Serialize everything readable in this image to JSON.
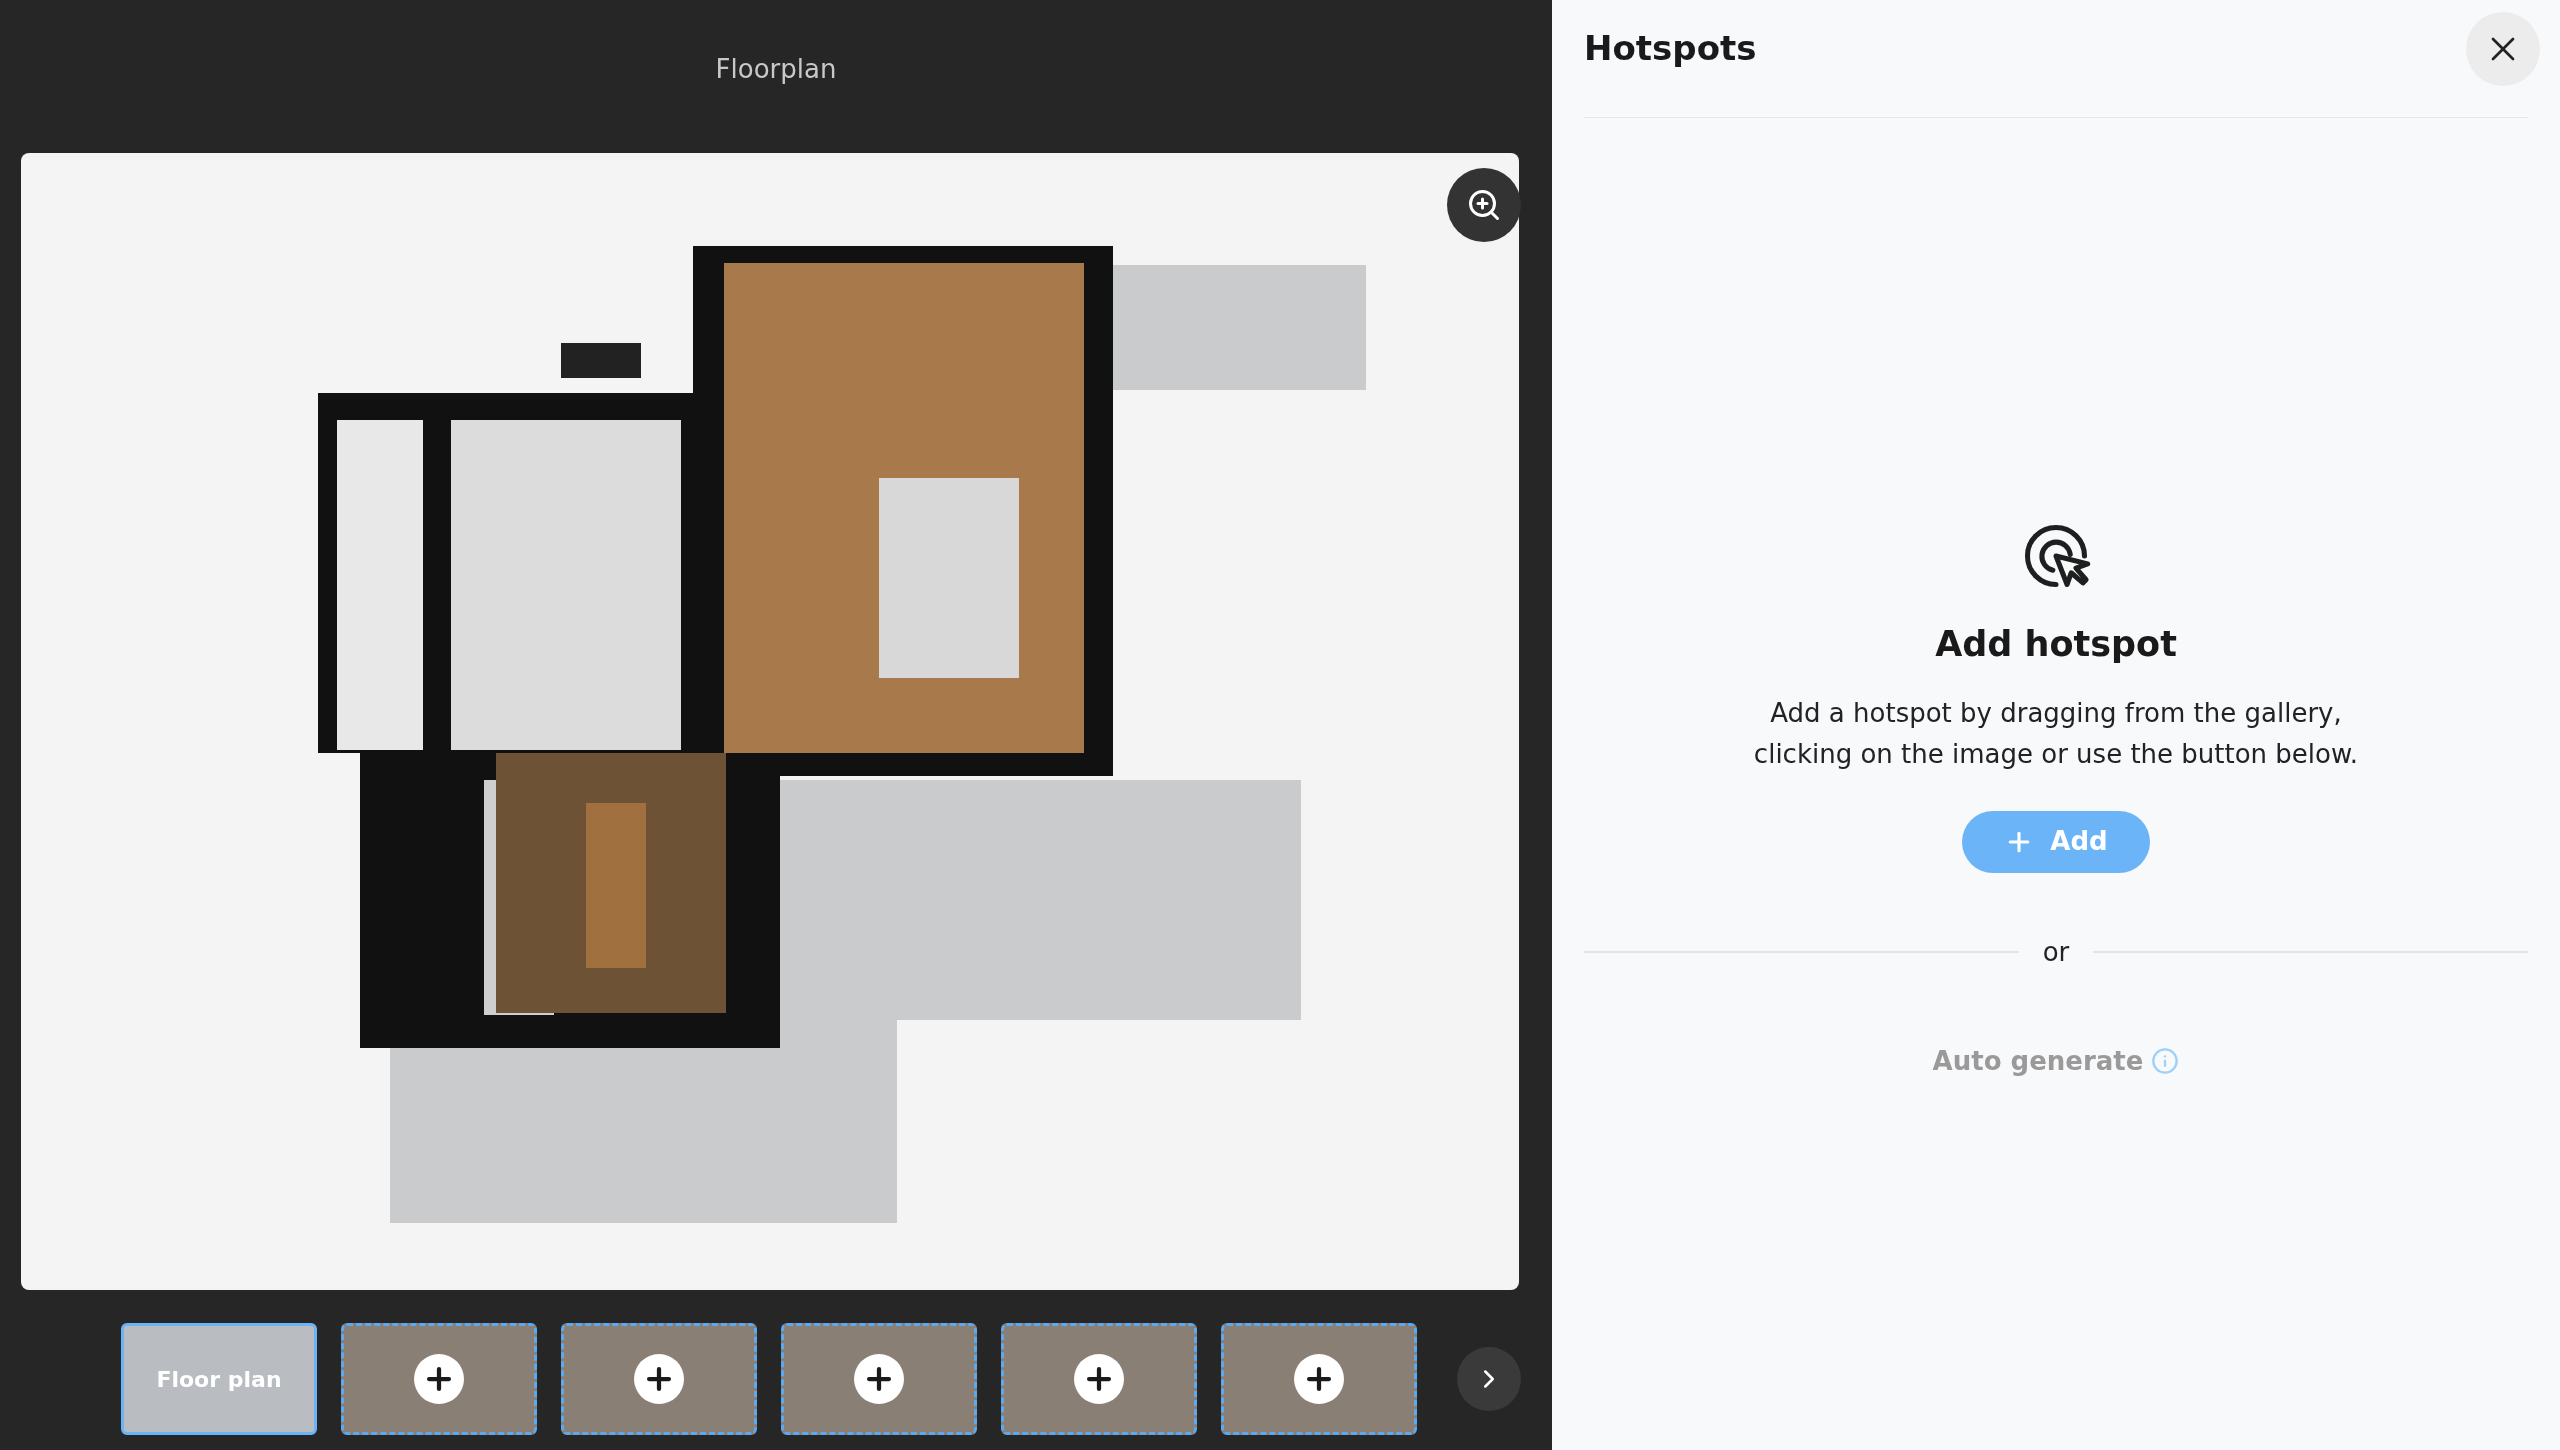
{
  "viewer": {
    "title": "Floorplan"
  },
  "thumbnails": [
    {
      "kind": "floorplan",
      "label": "Floor plan",
      "selected": true
    },
    {
      "kind": "panorama",
      "selected": false
    },
    {
      "kind": "panorama",
      "selected": false
    },
    {
      "kind": "panorama",
      "selected": false
    },
    {
      "kind": "panorama",
      "selected": false
    },
    {
      "kind": "panorama",
      "selected": false
    }
  ],
  "panel": {
    "title": "Hotspots",
    "empty_title": "Add hotspot",
    "empty_text": "Add a hotspot by dragging from the gallery, clicking on the image or use the button below.",
    "add_button": "Add",
    "separator": "or",
    "auto_generate": "Auto generate"
  }
}
